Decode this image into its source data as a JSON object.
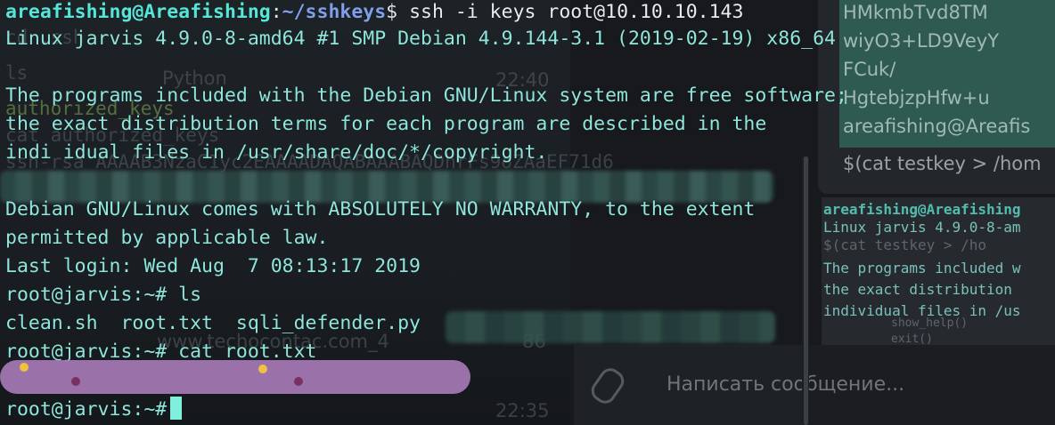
{
  "terminal": {
    "prompt_user": "areafishing@Areafishing",
    "prompt_sep": ":",
    "prompt_path": "~/sshkeys",
    "prompt_dollar": "$",
    "command": " ssh -i keys root@10.10.10.143",
    "lines": [
      "Linux jarvis 4.9.0-8-amd64 #1 SMP Debian 4.9.144-3.1 (2019-02-19) x86_64",
      "",
      "The programs included with the Debian GNU/Linux system are free software;",
      "the exact distribution terms for each program are described in the",
      "indi idual files in /usr/share/doc/*/copyright.",
      "",
      "Debian GNU/Linux comes with ABSOLUTELY NO WARRANTY, to the extent",
      "permitted by applicable law.",
      "Last login: Wed Aug  7 08:13:17 2019",
      "root@jarvis:~# ls",
      "clean.sh  root.txt  sqli_defender.py",
      "root@jarvis:~# cat root.txt"
    ],
    "final_prompt": "root@jarvis:~#"
  },
  "background": {
    "ghost_texts": [
      "cd .ssh",
      "ls",
      "Python",
      "22:40",
      "authorized_keys",
      "cat authorized_keys",
      "ssh-rsa AAAAB3NzaC1yc2EAAAADAQABAAABAQDhrFs9oZAaEF71d6",
      "22:35",
      "www.techocontac.com_4",
      "86"
    ],
    "right_panel_texts": [
      "HMkmbTvd8TM",
      "wiyO3+LD9VeyY",
      "FCuk/",
      "HgtebjzpHfw+u",
      "areafishing@Areafis",
      "$(cat testkey > /hom"
    ],
    "code_panel_lines": [
      "areafishing@Areafishing",
      "Linux jarvis 4.9.0-8-am",
      "  $(cat testkey > /ho",
      "The programs included w",
      "the exact distribution",
      "individual files in /us",
      "    show_help()",
      "    exit()"
    ],
    "message_placeholder": "Написать сообщение..."
  },
  "colors": {
    "terminal_text": "#8ee6dc",
    "prompt_user": "#56e6d8",
    "prompt_path": "#7fa0e8",
    "cursor": "#7ff0dc",
    "scribble": "#a678b4"
  }
}
